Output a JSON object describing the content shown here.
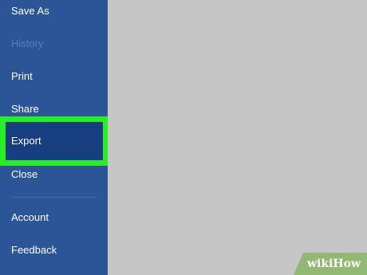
{
  "sidebar": {
    "items": [
      {
        "label": "Save As",
        "disabled": false
      },
      {
        "label": "History",
        "disabled": true
      },
      {
        "label": "Print",
        "disabled": false
      },
      {
        "label": "Share",
        "disabled": false
      },
      {
        "label": "Export",
        "disabled": false,
        "highlighted": true
      },
      {
        "label": "Close",
        "disabled": false
      },
      {
        "label": "Account",
        "disabled": false
      },
      {
        "label": "Feedback",
        "disabled": false
      }
    ]
  },
  "colors": {
    "sidebar_bg": "#2b5597",
    "selected_bg": "#173f7f",
    "highlight_border": "#27ee25",
    "main_bg": "#c6c6c6",
    "watermark_bg": "#93b874"
  },
  "watermark": {
    "wiki": "wiki",
    "how": "How"
  }
}
